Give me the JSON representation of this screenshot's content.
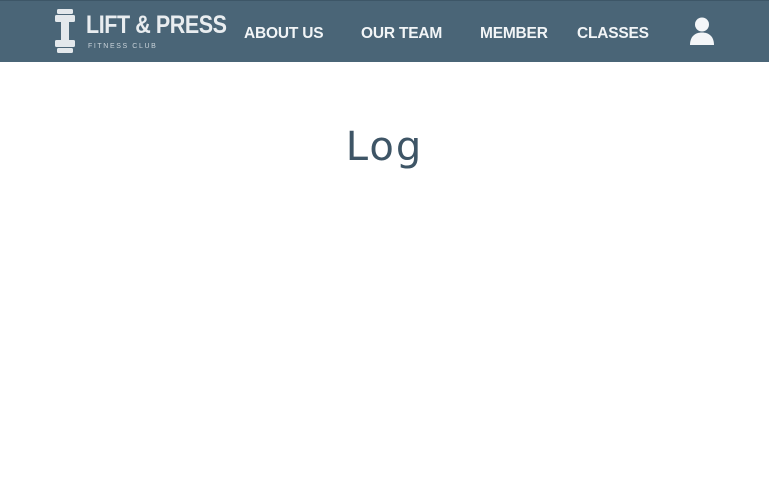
{
  "brand": {
    "title": "LIFT & PRESS",
    "subtitle": "FITNESS CLUB",
    "logo_icon": "dumbbell-icon"
  },
  "nav": {
    "items": [
      {
        "label": "ABOUT US"
      },
      {
        "label": "OUR TEAM"
      },
      {
        "label": "MEMBER"
      },
      {
        "label": "CLASSES"
      }
    ],
    "account_icon": "user-icon"
  },
  "main": {
    "title": "Log"
  },
  "colors": {
    "navbar": "#4a6577",
    "nav_text": "#f2f5f7",
    "title_text": "#3e5566",
    "background": "#ffffff"
  }
}
